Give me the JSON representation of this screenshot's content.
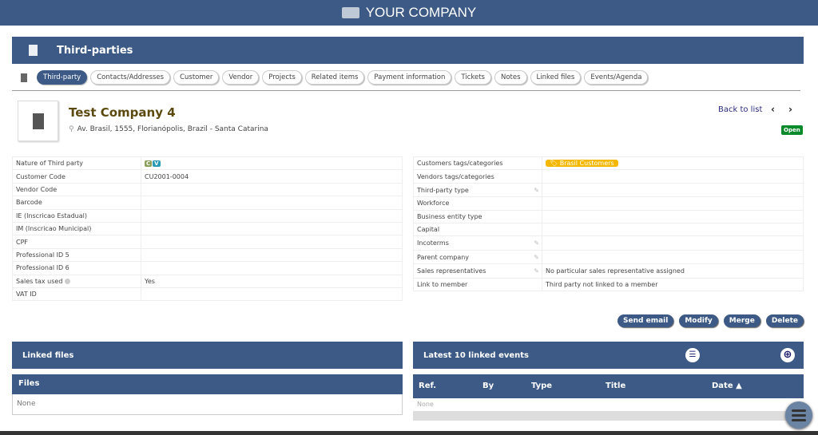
{
  "app": {
    "company": "YOUR COMPANY"
  },
  "module": {
    "title": "Third-parties"
  },
  "tabs": [
    "Third-party",
    "Contacts/Addresses",
    "Customer",
    "Vendor",
    "Projects",
    "Related items",
    "Payment information",
    "Tickets",
    "Notes",
    "Linked files",
    "Events/Agenda"
  ],
  "company": {
    "name": "Test Company 4",
    "address": "Av. Brasil, 1555, Florianópolis, Brazil - Santa Catarina",
    "status": "Open"
  },
  "nav": {
    "back": "Back to list",
    "prev": "‹",
    "next": "›"
  },
  "left_fields": [
    {
      "label": "Nature of Third party",
      "value": ""
    },
    {
      "label": "Customer Code",
      "value": "CU2001-0004"
    },
    {
      "label": "Vendor Code",
      "value": ""
    },
    {
      "label": "Barcode",
      "value": ""
    },
    {
      "label": "IE (Inscricao Estadual)",
      "value": ""
    },
    {
      "label": "IM (Inscricao Municipal)",
      "value": ""
    },
    {
      "label": "CPF",
      "value": ""
    },
    {
      "label": "Professional ID 5",
      "value": ""
    },
    {
      "label": "Professional ID 6",
      "value": ""
    },
    {
      "label": "Sales tax used",
      "value": "Yes"
    },
    {
      "label": "VAT ID",
      "value": ""
    }
  ],
  "nature_badges": [
    {
      "text": "C",
      "color": "#8aa05a"
    },
    {
      "text": "V",
      "color": "#2a9ab5"
    }
  ],
  "right_fields": [
    {
      "label": "Customers tags/categories",
      "value": "Brasil Customers"
    },
    {
      "label": "Vendors tags/categories",
      "value": ""
    },
    {
      "label": "Third-party type",
      "value": ""
    },
    {
      "label": "Workforce",
      "value": ""
    },
    {
      "label": "Business entity type",
      "value": ""
    },
    {
      "label": "Capital",
      "value": ""
    },
    {
      "label": "Incoterms",
      "value": ""
    },
    {
      "label": "Parent company",
      "value": ""
    },
    {
      "label": "Sales representatives",
      "value": "No particular sales representative assigned"
    },
    {
      "label": "Link to member",
      "value": "Third party not linked to a member"
    }
  ],
  "actions": {
    "send_email": "Send email",
    "modify": "Modify",
    "merge": "Merge",
    "delete": "Delete"
  },
  "linked_files": {
    "title": "Linked files",
    "header": "Files",
    "empty": "None"
  },
  "events": {
    "title": "Latest 10 linked events",
    "columns": [
      "Ref.",
      "By",
      "Type",
      "Title",
      "Date ▲"
    ],
    "empty": "None"
  }
}
